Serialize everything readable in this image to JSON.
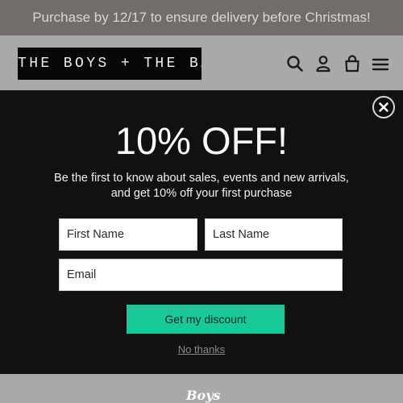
{
  "announcement": {
    "text": "Purchase by 12/17 to ensure delivery before Christmas!"
  },
  "header": {
    "logo_text": "THE BOYS + THE BABE",
    "icons": [
      "search-icon",
      "user-icon",
      "cart-icon",
      "menu-icon"
    ]
  },
  "popup": {
    "title": "10% OFF!",
    "subtitle": "Be the first to know about sales, events and new arrivals, and get 10% off your first purchase",
    "first_name_placeholder": "First Name",
    "last_name_placeholder": "Last Name",
    "email_placeholder": "Email",
    "submit_label": "Get my discount",
    "dismiss_label": "No thanks",
    "close_icon": "close-icon"
  },
  "footer": {
    "logo_text": "Boys"
  },
  "colors": {
    "announcement_bg": "#726d6b",
    "page_bg": "#a9a9a9",
    "popup_bg": "#111111",
    "accent": "#17c997"
  }
}
